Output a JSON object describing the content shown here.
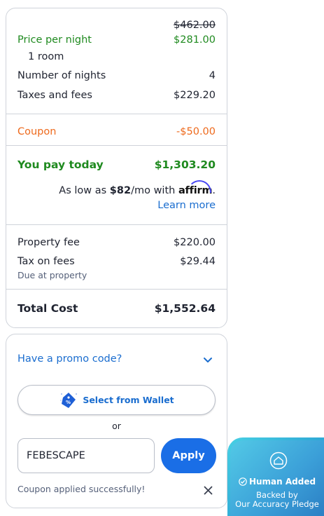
{
  "summary": {
    "original_price": "$462.00",
    "price_per_night_label": "Price per night",
    "price_per_night_value": "$281.00",
    "rooms": "1 room",
    "nights_label": "Number of nights",
    "nights_value": "4",
    "taxes_label": "Taxes and fees",
    "taxes_value": "$229.20",
    "coupon_label": "Coupon",
    "coupon_value": "-$50.00",
    "pay_today_label": "You pay today",
    "pay_today_value": "$1,303.20",
    "affirm_prefix": "As low as",
    "affirm_amount": "$82",
    "affirm_suffix": "/mo with",
    "affirm_brand": "affirm",
    "affirm_period": ".",
    "learn_more": "Learn more",
    "property_fee_label": "Property fee",
    "property_fee_value": "$220.00",
    "tax_on_fees_label": "Tax on fees",
    "tax_on_fees_value": "$29.44",
    "due_at_property": "Due at property",
    "total_label": "Total Cost",
    "total_value": "$1,552.64"
  },
  "promo": {
    "toggle_label": "Have a promo code?",
    "wallet_button": "Select from Wallet",
    "or_text": "or",
    "code_value": "FEBESCAPE",
    "apply_label": "Apply",
    "success_message": "Coupon applied successfully!"
  },
  "pledge": {
    "title": "Human Added",
    "line1": "Backed by",
    "line2": "Our Accuracy Pledge"
  },
  "colors": {
    "green": "#1f8a1f",
    "orange": "#ee6a1d",
    "link": "#1a6dcf",
    "apply": "#1a6ee6"
  },
  "icons": [
    "chevron-down-icon",
    "wallet-tag-icon",
    "close-icon",
    "shield-icon",
    "check-circle-icon"
  ]
}
